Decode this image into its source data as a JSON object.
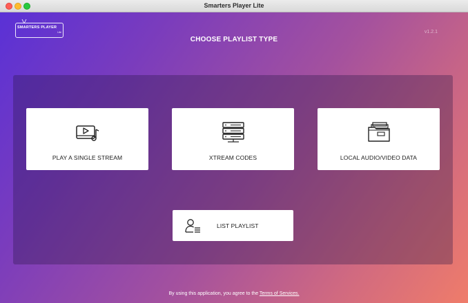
{
  "window": {
    "title": "Smarters Player Lite"
  },
  "header": {
    "logo_text": "SMARTERS PLAYER",
    "logo_sub": "Lite",
    "title": "CHOOSE PLAYLIST TYPE",
    "version": "v1.2.1"
  },
  "options": [
    {
      "label": "PLAY A SINGLE STREAM",
      "icon": "video-play-icon"
    },
    {
      "label": "XTREAM CODES",
      "icon": "server-icon"
    },
    {
      "label": "LOCAL AUDIO/VIDEO DATA",
      "icon": "folder-files-icon"
    }
  ],
  "list_playlist": {
    "label": "LIST PLAYLIST",
    "icon": "user-list-icon"
  },
  "footer": {
    "prefix": "By using this application, you agree to the ",
    "link": "Terms of Services."
  },
  "colors": {
    "gradient_start": "#5a31d6",
    "gradient_end": "#ef7c6a",
    "card_bg": "#ffffff"
  }
}
